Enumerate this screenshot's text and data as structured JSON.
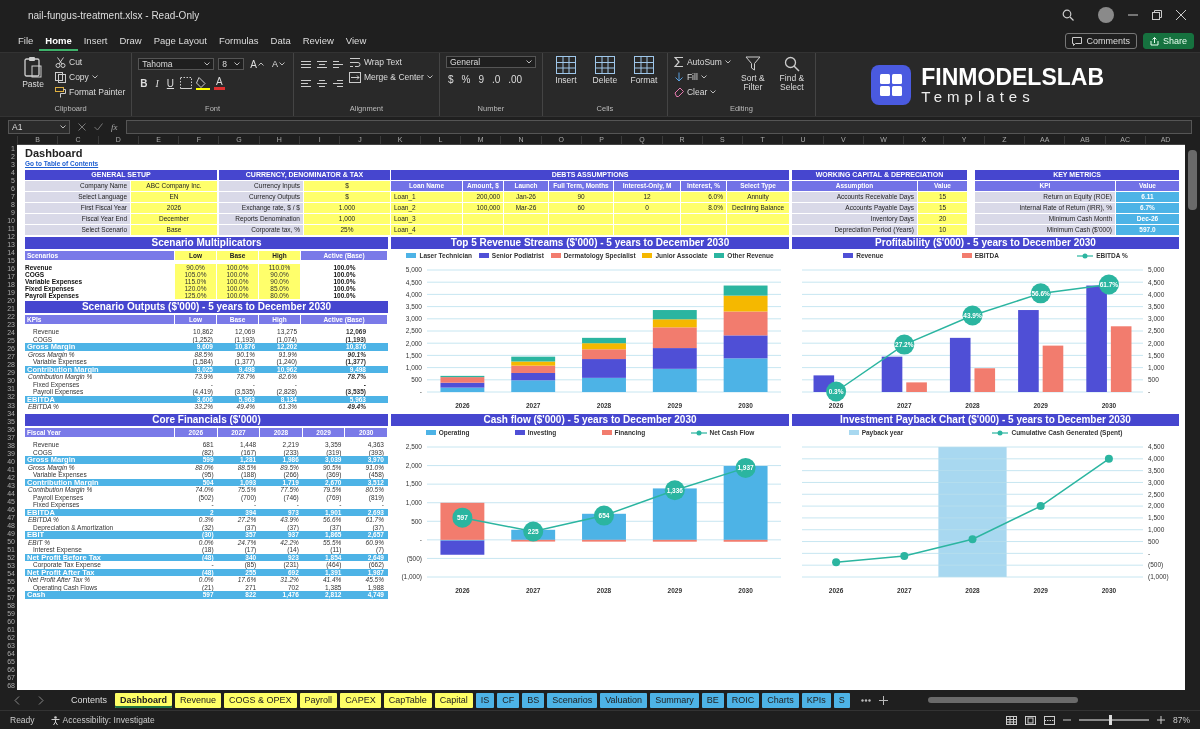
{
  "title_bar": {
    "title": "nail-fungus-treatment.xlsx - Read-Only"
  },
  "menu": {
    "items": [
      {
        "label": "File",
        "selected": false
      },
      {
        "label": "Home",
        "selected": true
      },
      {
        "label": "Insert",
        "selected": false
      },
      {
        "label": "Draw",
        "selected": false
      },
      {
        "label": "Page Layout",
        "selected": false
      },
      {
        "label": "Formulas",
        "selected": false
      },
      {
        "label": "Data",
        "selected": false
      },
      {
        "label": "Review",
        "selected": false
      },
      {
        "label": "View",
        "selected": false
      }
    ],
    "buttons": [
      {
        "label": "Comments",
        "kind": "outline"
      },
      {
        "label": "Share",
        "kind": "primary"
      }
    ]
  },
  "ribbon": {
    "groups": [
      {
        "kind": "clipboard",
        "label": "Clipboard",
        "large": [
          "Paste"
        ],
        "small": [
          "Cut",
          "Copy",
          "Format Painter"
        ]
      },
      {
        "kind": "font",
        "label": "Font",
        "font": "Tahoma",
        "size": "8",
        "grow": "A",
        "shrink": "A",
        "styles": [
          "B",
          "I",
          "U"
        ],
        "color_key": "A"
      },
      {
        "kind": "alignment",
        "label": "Alignment",
        "small": [
          "Wrap Text",
          "Merge & Center"
        ]
      },
      {
        "kind": "number",
        "label": "Number",
        "format": "General",
        "symbols": [
          "$",
          "%",
          "9",
          ".0",
          ".00"
        ]
      },
      {
        "kind": "cells",
        "label": "Cells",
        "large": [
          "Insert",
          "Delete",
          "Format"
        ]
      },
      {
        "kind": "editing",
        "label": "Editing",
        "small": [
          "AutoSum",
          "Fill",
          "Clear"
        ],
        "large": [
          "Sort & Filter",
          "Find & Select"
        ]
      }
    ],
    "logo": {
      "name": "FINMODELSLAB",
      "tagline": "Templates"
    }
  },
  "formula_bar": {
    "name_box": "A1",
    "function_label": "fx"
  },
  "column_headers": [
    "B",
    "C",
    "D",
    "E",
    "F",
    "G",
    "H",
    "I",
    "J",
    "K",
    "L",
    "M",
    "N",
    "O",
    "P",
    "Q",
    "R",
    "S",
    "T",
    "U",
    "V",
    "W",
    "X",
    "Y",
    "Z",
    "AA",
    "AB",
    "AC",
    "AD"
  ],
  "row_numbers": [
    "1",
    "2",
    "3",
    "4",
    "5",
    "6",
    "7",
    "8",
    "9",
    "10",
    "11",
    "12",
    "13",
    "14",
    "15",
    "16",
    "17",
    "18",
    "19",
    "20",
    "21",
    "22",
    "23",
    "24",
    "25",
    "26",
    "27",
    "28",
    "29",
    "30",
    "31",
    "32",
    "33",
    "34",
    "35",
    "36",
    "37",
    "38",
    "39",
    "40",
    "41",
    "42",
    "43",
    "44",
    "45",
    "46",
    "47",
    "48",
    "49",
    "50",
    "51",
    "52",
    "53",
    "54",
    "55",
    "56",
    "57",
    "58",
    "59",
    "60",
    "61",
    "62",
    "63",
    "64",
    "65",
    "66",
    "67",
    "68"
  ],
  "sheet": {
    "title": "Dashboard",
    "link": "Go to Table of Contents",
    "general_setup": {
      "title": "GENERAL SETUP",
      "rows": [
        {
          "cells": [
            "Company Name",
            "ABC Company Inc."
          ]
        },
        {
          "cells": [
            "Select Language",
            "EN"
          ]
        },
        {
          "cells": [
            "First Fiscal Year",
            "2026"
          ]
        },
        {
          "cells": [
            "Fiscal Year End",
            "December"
          ]
        },
        {
          "cells": [
            "Select Scenario",
            "Base"
          ]
        }
      ]
    },
    "currency": {
      "title": "CURRENCY, DENOMINATOR & TAX",
      "rows": [
        {
          "cells": [
            "Currency Inputs",
            "$"
          ]
        },
        {
          "cells": [
            "Currency Outputs",
            "$"
          ]
        },
        {
          "cells": [
            "Exchange rate, $ / $",
            "1.000"
          ]
        },
        {
          "cells": [
            "Reports Denomination",
            "1,000"
          ]
        },
        {
          "cells": [
            "Corporate tax, %",
            "25%"
          ]
        }
      ]
    },
    "debts": {
      "title": "DEBTS ASSUMPTIONS",
      "columns": [
        "Loan Name",
        "Amount, $",
        "Launch",
        "Full Term, Months",
        "Interest-Only, M",
        "Interest, %",
        "Select Type"
      ],
      "rows": [
        {
          "cells": [
            "Loan_1",
            "200,000",
            "Jan-26",
            "90",
            "12",
            "6.0%",
            "Annuity"
          ]
        },
        {
          "cells": [
            "Loan_2",
            "100,000",
            "Mar-26",
            "60",
            "0",
            "8.0%",
            "Declining Balance"
          ]
        },
        {
          "cells": [
            "Loan_3"
          ]
        },
        {
          "cells": [
            "Loan_4"
          ]
        }
      ]
    },
    "working_capital": {
      "title": "WORKING CAPITAL & DEPRECIATION",
      "columns": [
        "Assumption",
        "Value"
      ],
      "rows": [
        {
          "cells": [
            "Accounts Receivable Days",
            "15"
          ]
        },
        {
          "cells": [
            "Accounts Payable Days",
            "15"
          ]
        },
        {
          "cells": [
            "Inventory Days",
            "20"
          ]
        },
        {
          "cells": [
            "Depreciation Period (Years)",
            "10"
          ]
        }
      ]
    },
    "key_metrics": {
      "title": "KEY METRICS",
      "columns": [
        "KPI",
        "Value"
      ],
      "rows": [
        {
          "cells": [
            "Return on Equity (ROE)",
            "6.11"
          ]
        },
        {
          "cells": [
            "Internal Rate of Return (IRR), %",
            "6.7%"
          ]
        },
        {
          "cells": [
            "Minimum Cash Month",
            "Dec-26"
          ]
        },
        {
          "cells": [
            "Minimum Cash ($'000)",
            "597.0"
          ]
        }
      ]
    },
    "scenario_multiplicators": {
      "title": "Scenario Multiplicators",
      "columns": [
        "Scenarios",
        "Low",
        "Base",
        "High",
        "Active (Base)"
      ],
      "rows": [
        {
          "label": "Revenue",
          "values": [
            "90.0%",
            "100.0%",
            "110.0%",
            "100.0%"
          ]
        },
        {
          "label": "COGS",
          "values": [
            "105.0%",
            "100.0%",
            "90.0%",
            "100.0%"
          ]
        },
        {
          "label": "Variable Expenses",
          "values": [
            "115.0%",
            "100.0%",
            "90.0%",
            "100.0%"
          ]
        },
        {
          "label": "Fixed Expenses",
          "values": [
            "120.0%",
            "100.0%",
            "85.0%",
            "100.0%"
          ]
        },
        {
          "label": "Payroll Expenses",
          "values": [
            "125.0%",
            "100.0%",
            "80.0%",
            "100.0%"
          ]
        }
      ]
    },
    "scenario_outputs": {
      "title": "Scenario Outputs ($'000) - 5 years to December 2030",
      "columns": [
        "KPIs",
        "Low",
        "Base",
        "High",
        "Active (Base)"
      ],
      "rows": [
        {
          "kind": "line",
          "label": "Revenue",
          "values": [
            "10,862",
            "12,069",
            "13,275",
            "12,069"
          ]
        },
        {
          "kind": "line",
          "label": "COGS",
          "values": [
            "(1,252)",
            "(1,193)",
            "(1,074)",
            "(1,193)"
          ]
        },
        {
          "kind": "subtotal",
          "label": "Gross Margin",
          "values": [
            "9,609",
            "10,876",
            "12,202",
            "10,876"
          ]
        },
        {
          "kind": "percent",
          "label": "Gross Margin %",
          "values": [
            "88.5%",
            "90.1%",
            "91.9%",
            "90.1%"
          ]
        },
        {
          "kind": "line",
          "label": "Variable Expenses",
          "values": [
            "(1,584)",
            "(1,377)",
            "(1,240)",
            "(1,377)"
          ]
        },
        {
          "kind": "subtotal",
          "label": "Contribution Margin",
          "values": [
            "8,025",
            "9,498",
            "10,962",
            "9,498"
          ]
        },
        {
          "kind": "percent",
          "label": "Contribution Margin %",
          "values": [
            "73.9%",
            "78.7%",
            "82.6%",
            "78.7%"
          ]
        },
        {
          "kind": "line",
          "label": "Fixed Expenses",
          "values": [
            "-",
            "-",
            "-",
            "-"
          ]
        },
        {
          "kind": "line",
          "label": "Payroll Expenses",
          "values": [
            "(4,419)",
            "(3,535)",
            "(2,828)",
            "(3,535)"
          ]
        },
        {
          "kind": "subtotal",
          "label": "EBITDA",
          "values": [
            "3,606",
            "5,963",
            "8,134",
            "5,963"
          ]
        },
        {
          "kind": "percent",
          "label": "EBITDA %",
          "values": [
            "33.2%",
            "49.4%",
            "61.3%",
            "49.4%"
          ]
        }
      ]
    },
    "core_financials": {
      "title": "Core Financials ($'000)",
      "columns": [
        "Fiscal Year",
        "2026",
        "2027",
        "2028",
        "2029",
        "2030"
      ],
      "rows": [
        {
          "kind": "line",
          "label": "Revenue",
          "values": [
            "681",
            "1,448",
            "2,219",
            "3,359",
            "4,363"
          ]
        },
        {
          "kind": "line",
          "label": "COGS",
          "values": [
            "(82)",
            "(167)",
            "(233)",
            "(319)",
            "(393)"
          ]
        },
        {
          "kind": "subtotal",
          "label": "Gross Margin",
          "values": [
            "599",
            "1,281",
            "1,986",
            "3,039",
            "3,970"
          ]
        },
        {
          "kind": "percent",
          "label": "Gross Margin %",
          "values": [
            "88.0%",
            "88.5%",
            "89.5%",
            "90.5%",
            "91.0%"
          ]
        },
        {
          "kind": "line",
          "label": "Variable Expenses",
          "values": [
            "(95)",
            "(188)",
            "(266)",
            "(369)",
            "(458)"
          ]
        },
        {
          "kind": "subtotal",
          "label": "Contribution Margin",
          "values": [
            "504",
            "1,093",
            "1,719",
            "2,670",
            "3,512"
          ]
        },
        {
          "kind": "percent",
          "label": "Contribution Margin %",
          "values": [
            "74.0%",
            "75.5%",
            "77.5%",
            "79.5%",
            "80.5%"
          ]
        },
        {
          "kind": "line",
          "label": "Payroll Expenses",
          "values": [
            "(502)",
            "(700)",
            "(746)",
            "(769)",
            "(819)"
          ]
        },
        {
          "kind": "line",
          "label": "Fixed Expenses",
          "values": [
            "-",
            "-",
            "-",
            "-",
            "-"
          ]
        },
        {
          "kind": "subtotal",
          "label": "EBITDA",
          "values": [
            "2",
            "394",
            "973",
            "1,901",
            "2,693"
          ]
        },
        {
          "kind": "percent",
          "label": "EBITDA %",
          "values": [
            "0.3%",
            "27.2%",
            "43.9%",
            "56.6%",
            "61.7%"
          ]
        },
        {
          "kind": "line",
          "label": "Depreciation & Amortization",
          "values": [
            "(32)",
            "(37)",
            "(37)",
            "(37)",
            "(37)"
          ]
        },
        {
          "kind": "subtotal",
          "label": "EBIT",
          "values": [
            "(30)",
            "357",
            "937",
            "1,865",
            "2,657"
          ]
        },
        {
          "kind": "percent",
          "label": "EBIT %",
          "values": [
            "0.0%",
            "24.7%",
            "42.2%",
            "55.5%",
            "60.9%"
          ]
        },
        {
          "kind": "line",
          "label": "Interest Expense",
          "values": [
            "(18)",
            "(17)",
            "(14)",
            "(11)",
            "(7)"
          ]
        },
        {
          "kind": "subtotal",
          "label": "Net Profit Before Tax",
          "values": [
            "(48)",
            "340",
            "923",
            "1,854",
            "2,649"
          ]
        },
        {
          "kind": "line",
          "label": "Corporate Tax Expense",
          "values": [
            "-",
            "(85)",
            "(231)",
            "(464)",
            "(662)"
          ]
        },
        {
          "kind": "subtotal",
          "label": "Net Profit After Tax",
          "values": [
            "(48)",
            "255",
            "692",
            "1,391",
            "1,987"
          ]
        },
        {
          "kind": "percent",
          "label": "Net Profit After Tax %",
          "values": [
            "0.0%",
            "17.6%",
            "31.2%",
            "41.4%",
            "45.5%"
          ]
        },
        {
          "kind": "line",
          "label": "Operating Cash Flows",
          "values": [
            "(21)",
            "271",
            "702",
            "1,385",
            "1,988"
          ]
        },
        {
          "kind": "subtotal",
          "label": "Cash",
          "values": [
            "597",
            "822",
            "1,476",
            "2,812",
            "4,749"
          ]
        }
      ]
    },
    "charts": [
      {
        "chart_data": {
          "type": "bar",
          "title": "Top 5 Revenue Streams ($'000) - 5 years to December 2030",
          "categories": [
            "2026",
            "2027",
            "2028",
            "2029",
            "2030"
          ],
          "stacked": true,
          "grid": true,
          "legend": "top",
          "ylim": [
            0,
            5000
          ],
          "yticks": [
            {
              "value": 0,
              "label": "-"
            },
            {
              "value": 500,
              "label": "500"
            },
            {
              "value": 1000,
              "label": "1,000"
            },
            {
              "value": 1500,
              "label": "1,500"
            },
            {
              "value": 2000,
              "label": "2,000"
            },
            {
              "value": 2500,
              "label": "2,500"
            },
            {
              "value": 3000,
              "label": "3,000"
            },
            {
              "value": 3500,
              "label": "3,500"
            },
            {
              "value": 4000,
              "label": "4,000"
            },
            {
              "value": 4500,
              "label": "4,500"
            },
            {
              "value": 5000,
              "label": "5,000"
            }
          ],
          "series": [
            {
              "name": "Laser Technician",
              "type": "bar",
              "color": "#4db3e6",
              "values": [
                180,
                480,
                580,
                950,
                1380
              ]
            },
            {
              "name": "Senior Podiatrist",
              "type": "bar",
              "color": "#4f4fd6",
              "values": [
                200,
                300,
                770,
                850,
                940
              ]
            },
            {
              "name": "Dermatology Specialist",
              "type": "bar",
              "color": "#f27c6e",
              "values": [
                230,
                300,
                400,
                850,
                980
              ]
            },
            {
              "name": "Junior Associate",
              "type": "bar",
              "color": "#f5b800",
              "values": [
                null,
                170,
                250,
                330,
                650
              ]
            },
            {
              "name": "Other Revenue",
              "type": "bar",
              "color": "#2bb5a0",
              "values": [
                51,
                198,
                219,
                379,
                413
              ]
            }
          ]
        }
      },
      {
        "chart_data": {
          "type": "bar",
          "title": "Profitability ($'000) - 5 years to December 2030",
          "categories": [
            "2026",
            "2027",
            "2028",
            "2029",
            "2030"
          ],
          "stacked": false,
          "grid": true,
          "legend": "top",
          "ylim": [
            0,
            5000
          ],
          "y2lim": [
            0,
            70
          ],
          "yticks": [
            {
              "value": 0,
              "label": "-"
            },
            {
              "value": 500,
              "label": "500"
            },
            {
              "value": 1000,
              "label": "1,000"
            },
            {
              "value": 1500,
              "label": "1,500"
            },
            {
              "value": 2000,
              "label": "2,000"
            },
            {
              "value": 2500,
              "label": "2,500"
            },
            {
              "value": 3000,
              "label": "3,000"
            },
            {
              "value": 3500,
              "label": "3,500"
            },
            {
              "value": 4000,
              "label": "4,000"
            },
            {
              "value": 4500,
              "label": "4,500"
            },
            {
              "value": 5000,
              "label": "5,000"
            }
          ],
          "series": [
            {
              "name": "Revenue",
              "type": "bar",
              "color": "#4f4fd6",
              "values": [
                681,
                1448,
                2219,
                3359,
                4363
              ]
            },
            {
              "name": "EBITDA",
              "type": "bar",
              "color": "#f27c6e",
              "values": [
                null,
                394,
                973,
                1901,
                2693
              ]
            },
            {
              "name": "EBITDA %",
              "type": "line",
              "axis": "y2",
              "marker": "circle",
              "color": "#2bb5a0",
              "values": [
                0.3,
                27.2,
                43.9,
                56.6,
                61.7
              ],
              "value_labels": [
                "0.3%",
                "27.2%",
                "43.9%",
                "56.6%",
                "61.7%"
              ]
            }
          ]
        }
      },
      {
        "chart_data": {
          "type": "bar",
          "title": "Cash flow ($'000) - 5 years to December 2030",
          "categories": [
            "2026",
            "2027",
            "2028",
            "2029",
            "2030"
          ],
          "stacked": true,
          "grid": true,
          "legend": "top",
          "ylim": [
            -1000,
            2500
          ],
          "yticks": [
            {
              "value": -1000,
              "label": "(1,000)"
            },
            {
              "value": -500,
              "label": "(500)"
            },
            {
              "value": 0,
              "label": "-"
            },
            {
              "value": 500,
              "label": "500"
            },
            {
              "value": 1000,
              "label": "1,000"
            },
            {
              "value": 1500,
              "label": "1,500"
            },
            {
              "value": 2000,
              "label": "2,000"
            },
            {
              "value": 2500,
              "label": "2,500"
            }
          ],
          "series": [
            {
              "name": "Operating",
              "type": "bar",
              "color": "#4db3e6",
              "values": [
                -21,
                271,
                702,
                1385,
                1988
              ]
            },
            {
              "name": "Investing",
              "type": "bar",
              "color": "#4f4fd6",
              "values": [
                -380,
                0,
                0,
                0,
                0
              ]
            },
            {
              "name": "Financing",
              "type": "bar",
              "color": "#f27c6e",
              "values": [
                998,
                -46,
                -48,
                -49,
                -51
              ]
            },
            {
              "name": "Net Cash Flow",
              "type": "line",
              "marker": "circle",
              "color": "#2bb5a0",
              "values": [
                597,
                225,
                654,
                1336,
                1937
              ],
              "value_labels": [
                "597",
                "225",
                "654",
                "1,336",
                "1,937"
              ]
            }
          ]
        }
      },
      {
        "chart_data": {
          "type": "line",
          "title": "Investment Payback Chart ($'000) - 5 years to December 2030",
          "categories": [
            "2026",
            "2027",
            "2028",
            "2029",
            "2030"
          ],
          "grid": true,
          "legend": "top",
          "bands": [
            {
              "axis": "x",
              "from": "2028",
              "to": "2028",
              "label": "Payback year",
              "color": "#a8d8f0"
            }
          ],
          "y2lim": [
            -1000,
            4500
          ],
          "y2ticks": [
            {
              "value": -1000,
              "label": "(1,000)"
            },
            {
              "value": -500,
              "label": "(500)"
            },
            {
              "value": 0,
              "label": "-"
            },
            {
              "value": 500,
              "label": "500"
            },
            {
              "value": 1000,
              "label": "1,000"
            },
            {
              "value": 1500,
              "label": "1,500"
            },
            {
              "value": 2000,
              "label": "2,000"
            },
            {
              "value": 2500,
              "label": "2,500"
            },
            {
              "value": 3000,
              "label": "3,000"
            },
            {
              "value": 3500,
              "label": "3,500"
            },
            {
              "value": 4000,
              "label": "4,000"
            },
            {
              "value": 4500,
              "label": "4,500"
            }
          ],
          "series": [
            {
              "name": "Cumulative Cash Generated (Spent)",
              "type": "line",
              "axis": "y2",
              "marker": "circle",
              "color": "#2bb5a0",
              "values": [
                -380,
                -110,
                600,
                2000,
                4000
              ]
            }
          ]
        }
      }
    ]
  },
  "sheet_tabs": {
    "items": [
      {
        "label": "Contents",
        "selected": false
      },
      {
        "label": "Dashboard",
        "selected": true,
        "color": "#ffff66"
      },
      {
        "label": "Revenue",
        "selected": false,
        "color": "#ffff66"
      },
      {
        "label": "COGS & OPEX",
        "selected": false,
        "color": "#ffff66"
      },
      {
        "label": "Payroll",
        "selected": false,
        "color": "#ffff66"
      },
      {
        "label": "CAPEX",
        "selected": false,
        "color": "#ffff66"
      },
      {
        "label": "CapTable",
        "selected": false,
        "color": "#ffff66"
      },
      {
        "label": "Capital",
        "selected": false,
        "color": "#ffff66"
      },
      {
        "label": "IS",
        "selected": false,
        "color": "#4db3e6"
      },
      {
        "label": "CF",
        "selected": false,
        "color": "#4db3e6"
      },
      {
        "label": "BS",
        "selected": false,
        "color": "#4db3e6"
      },
      {
        "label": "Scenarios",
        "selected": false,
        "color": "#4db3e6"
      },
      {
        "label": "Valuation",
        "selected": false,
        "color": "#4db3e6"
      },
      {
        "label": "Summary",
        "selected": false,
        "color": "#4db3e6"
      },
      {
        "label": "BE",
        "selected": false,
        "color": "#4db3e6"
      },
      {
        "label": "ROIC",
        "selected": false,
        "color": "#4db3e6"
      },
      {
        "label": "Charts",
        "selected": false,
        "color": "#4db3e6"
      },
      {
        "label": "KPIs",
        "selected": false,
        "color": "#4db3e6"
      },
      {
        "label": "S",
        "selected": false,
        "color": "#4db3e6"
      }
    ]
  },
  "status_bar": {
    "status": "Ready",
    "accessibility": "Accessibility: Investigate",
    "zoom": {
      "level": 0.45,
      "reading": "87%"
    }
  }
}
